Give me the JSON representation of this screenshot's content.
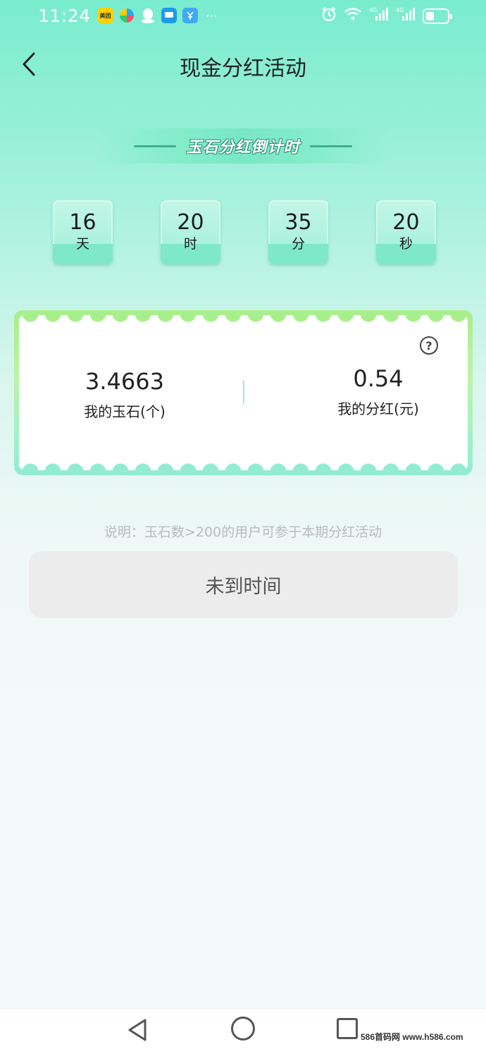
{
  "status_bar": {
    "time": "11:24",
    "left_icons": [
      "meituan-app-icon",
      "pinwheel-app-icon",
      "qq-icon",
      "message-app-icon",
      "wallet-app-icon"
    ],
    "meituan_label": "美团",
    "more": "···",
    "right_icons": [
      "alarm-icon",
      "wifi-icon",
      "signal-4g-icon",
      "signal-4g-icon-2",
      "battery-icon"
    ],
    "signal_label": "4G",
    "battery_level": 0.4
  },
  "header": {
    "title": "现金分红活动"
  },
  "countdown": {
    "title": "玉石分红倒计时",
    "items": [
      {
        "value": "16",
        "unit": "天"
      },
      {
        "value": "20",
        "unit": "时"
      },
      {
        "value": "35",
        "unit": "分"
      },
      {
        "value": "20",
        "unit": "秒"
      }
    ]
  },
  "card": {
    "help_symbol": "?",
    "stats": [
      {
        "value": "3.4663",
        "label": "我的玉石(个)"
      },
      {
        "value": "0.54",
        "label": "我的分红(元)"
      }
    ]
  },
  "note": "说明：玉石数>200的用户可参于本期分红活动",
  "action_button": "未到时间",
  "watermark": "586首码网 www.h586.com",
  "colors": {
    "accent": "#79ecd0",
    "card_border_top": "#a7ef8b",
    "card_border_bottom": "#92ecd2",
    "button_bg": "#ececec"
  }
}
